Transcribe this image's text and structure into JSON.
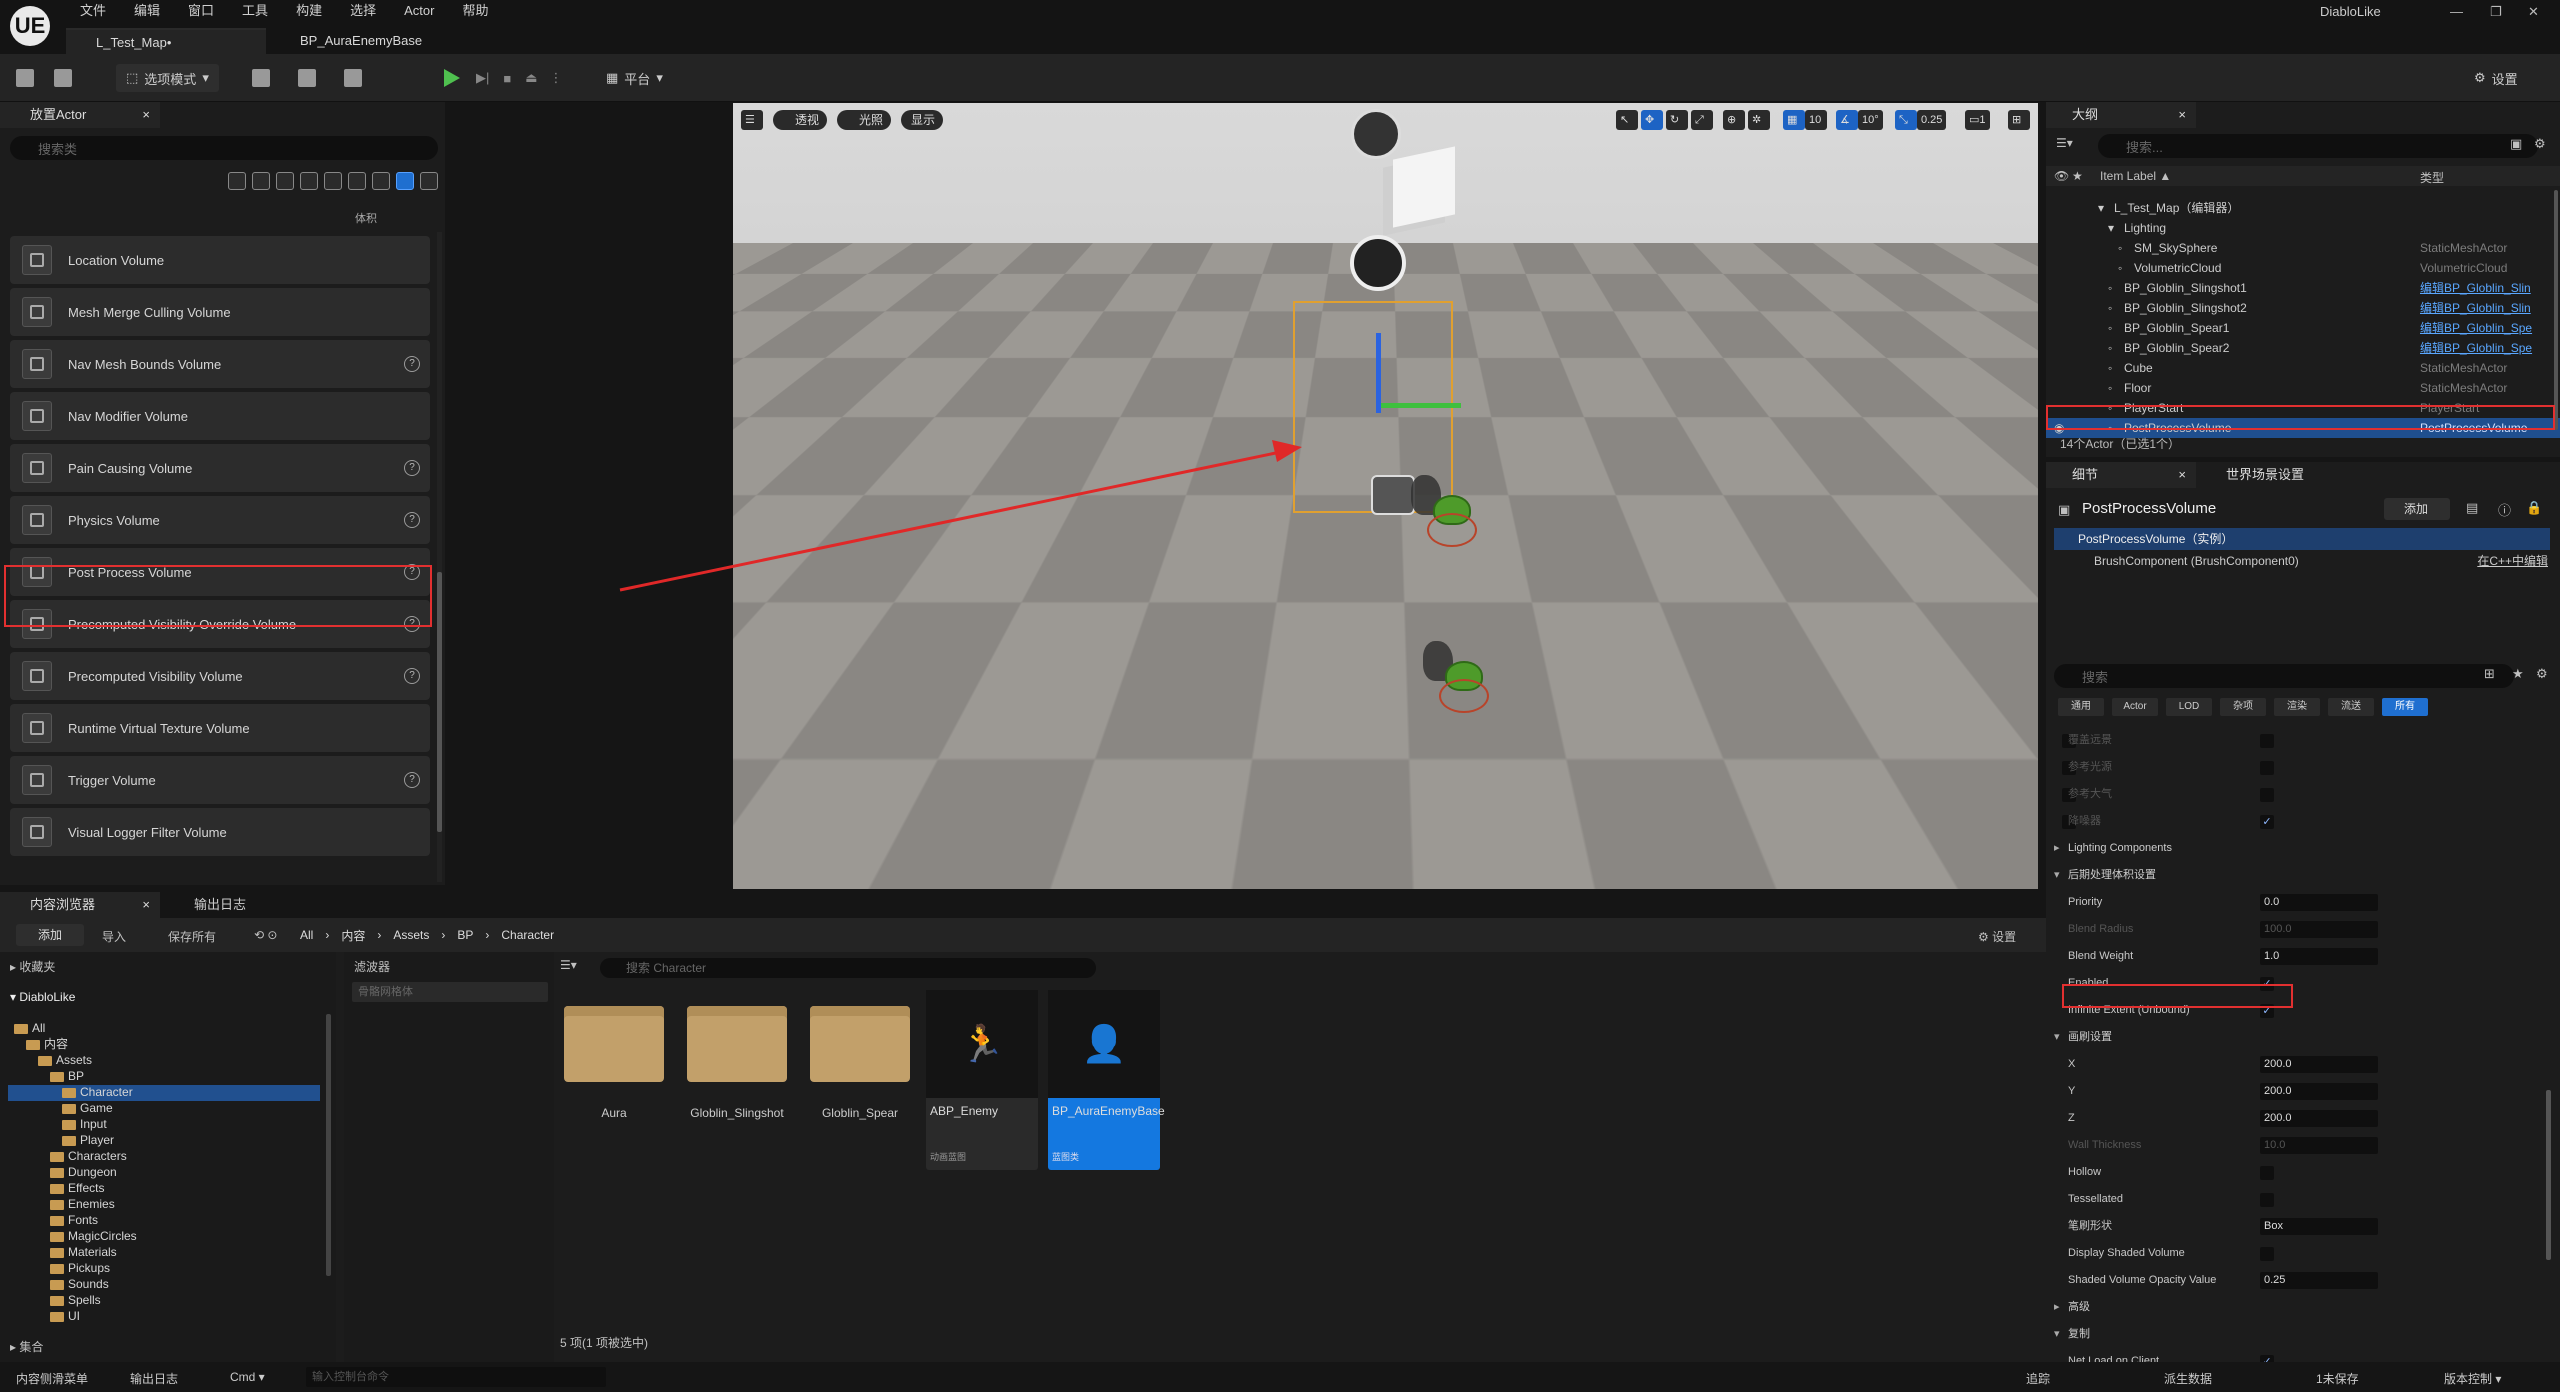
{
  "app": {
    "name": "DiabloLike",
    "logo": "UE"
  },
  "menu": [
    "文件",
    "编辑",
    "窗口",
    "工具",
    "构建",
    "选择",
    "Actor",
    "帮助"
  ],
  "doc_tabs": [
    "L_Test_Map•",
    "BP_AuraEnemyBase"
  ],
  "window_controls": [
    "—",
    "❐",
    "✕"
  ],
  "toolbar": {
    "mode": "选项模式",
    "platform": "平台",
    "settings": "设置"
  },
  "place_actor": {
    "tab": "放置Actor",
    "search_placeholder": "搜索类",
    "category_label": "体积",
    "volumes": [
      {
        "name": "Location Volume",
        "help": false
      },
      {
        "name": "Mesh Merge Culling Volume",
        "help": false
      },
      {
        "name": "Nav Mesh Bounds Volume",
        "help": true
      },
      {
        "name": "Nav Modifier Volume",
        "help": false
      },
      {
        "name": "Pain Causing Volume",
        "help": true
      },
      {
        "name": "Physics Volume",
        "help": true
      },
      {
        "name": "Post Process Volume",
        "help": true
      },
      {
        "name": "Precomputed Visibility Override Volume",
        "help": true
      },
      {
        "name": "Precomputed Visibility Volume",
        "help": true
      },
      {
        "name": "Runtime Virtual Texture Volume",
        "help": false
      },
      {
        "name": "Trigger Volume",
        "help": true
      },
      {
        "name": "Visual Logger Filter Volume",
        "help": false
      }
    ]
  },
  "viewport": {
    "perspective": "透视",
    "lit": "光照",
    "show": "显示",
    "grid": "10",
    "rot": "10°",
    "scale": "0.25",
    "cam": "1"
  },
  "outliner": {
    "tab": "大纲",
    "search_placeholder": "搜索...",
    "col_label": "Item Label ▲",
    "col_type": "类型",
    "rows": [
      {
        "label": "L_Test_Map（编辑器）",
        "type": "",
        "indent": 1
      },
      {
        "label": "Lighting",
        "type": "",
        "indent": 2
      },
      {
        "label": "SM_SkySphere",
        "type": "StaticMeshActor",
        "indent": 3
      },
      {
        "label": "VolumetricCloud",
        "type": "VolumetricCloud",
        "indent": 3
      },
      {
        "label": "BP_Globlin_Slingshot1",
        "type": "编辑BP_Globlin_Slin",
        "indent": 2,
        "link": true
      },
      {
        "label": "BP_Globlin_Slingshot2",
        "type": "编辑BP_Globlin_Slin",
        "indent": 2,
        "link": true
      },
      {
        "label": "BP_Globlin_Spear1",
        "type": "编辑BP_Globlin_Spe",
        "indent": 2,
        "link": true
      },
      {
        "label": "BP_Globlin_Spear2",
        "type": "编辑BP_Globlin_Spe",
        "indent": 2,
        "link": true
      },
      {
        "label": "Cube",
        "type": "StaticMeshActor",
        "indent": 2
      },
      {
        "label": "Floor",
        "type": "StaticMeshActor",
        "indent": 2
      },
      {
        "label": "PlayerStart",
        "type": "PlayerStart",
        "indent": 2
      },
      {
        "label": "PostProcessVolume",
        "type": "PostProcessVolume",
        "indent": 2,
        "selected": true
      }
    ],
    "count": "14个Actor（已选1个）"
  },
  "details": {
    "tab": "细节",
    "tab2": "世界场景设置",
    "actor": "PostProcessVolume",
    "add": "添加",
    "component_root": "PostProcessVolume（实例）",
    "component_child": "BrushComponent (BrushComponent0)",
    "edit_cpp": "在C++中编辑",
    "search_placeholder": "搜索",
    "filters": [
      "通用",
      "Actor",
      "LOD",
      "杂项",
      "渲染",
      "流送",
      "所有"
    ],
    "faded_rows": [
      "覆盖远景",
      "参考光源",
      "参考大气",
      "降噪器"
    ],
    "lighting_components": "Lighting Components",
    "post_section": "后期处理体积设置",
    "priority_l": "Priority",
    "priority": "0.0",
    "blend_radius_l": "Blend Radius",
    "blend_radius": "100.0",
    "blend_weight_l": "Blend Weight",
    "blend_weight": "1.0",
    "enabled_l": "Enabled",
    "infinite_l": "Infinite Extent (Unbound)",
    "brush_section": "画刷设置",
    "x_l": "X",
    "x": "200.0",
    "y_l": "Y",
    "y": "200.0",
    "z_l": "Z",
    "z": "200.0",
    "wall_l": "Wall Thickness",
    "wall": "10.0",
    "hollow_l": "Hollow",
    "tess_l": "Tessellated",
    "shape_l": "笔刷形状",
    "shape": "Box",
    "shaded_l": "Display Shaded Volume",
    "opacity_l": "Shaded Volume Opacity Value",
    "opacity": "0.25",
    "adv_section": "高级",
    "rep_section": "复制",
    "netload_l": "Net Load on Client"
  },
  "content_browser": {
    "tab": "内容浏览器",
    "tab2": "输出日志",
    "add": "添加",
    "import": "导入",
    "save_all": "保存所有",
    "settings": "设置",
    "breadcrumb": [
      "All",
      "内容",
      "Assets",
      "BP",
      "Character"
    ],
    "favorites": "收藏夹",
    "project": "DiabloLike",
    "filters": "滤波器",
    "filter_placeholder": "骨骼网格体",
    "search_placeholder": "搜索 Character",
    "collections": "集合",
    "tree": [
      {
        "n": "All",
        "d": 0
      },
      {
        "n": "内容",
        "d": 1
      },
      {
        "n": "Assets",
        "d": 2
      },
      {
        "n": "BP",
        "d": 3
      },
      {
        "n": "Character",
        "d": 4
      },
      {
        "n": "Game",
        "d": 4
      },
      {
        "n": "Input",
        "d": 4
      },
      {
        "n": "Player",
        "d": 4
      },
      {
        "n": "Characters",
        "d": 3
      },
      {
        "n": "Dungeon",
        "d": 3
      },
      {
        "n": "Effects",
        "d": 3
      },
      {
        "n": "Enemies",
        "d": 3
      },
      {
        "n": "Fonts",
        "d": 3
      },
      {
        "n": "MagicCircles",
        "d": 3
      },
      {
        "n": "Materials",
        "d": 3
      },
      {
        "n": "Pickups",
        "d": 3
      },
      {
        "n": "Sounds",
        "d": 3
      },
      {
        "n": "Spells",
        "d": 3
      },
      {
        "n": "UI",
        "d": 3
      }
    ],
    "folders": [
      "Aura",
      "Globlin_Slingshot",
      "Globlin_Spear"
    ],
    "assets": [
      {
        "name": "ABP_Enemy",
        "type": "动画蓝图"
      },
      {
        "name": "BP_AuraEnemyBase",
        "type": "蓝图类"
      }
    ],
    "status": "5 项(1 项被选中)"
  },
  "statusbar": {
    "drawer": "内容侧滑菜单",
    "log": "输出日志",
    "cmd": "Cmd",
    "cmd_placeholder": "输入控制台命令",
    "trace": "追踪",
    "derived": "派生数据",
    "unsaved": "1未保存",
    "source": "版本控制"
  }
}
